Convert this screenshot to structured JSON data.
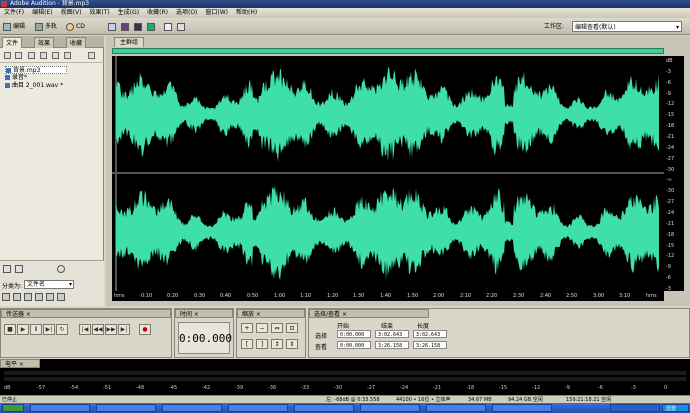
{
  "window": {
    "title": "Adobe Audition - 背景.mp3"
  },
  "menu": [
    "文件(F)",
    "编辑(E)",
    "视图(V)",
    "效果(T)",
    "生成(G)",
    "收藏(R)",
    "选项(O)",
    "窗口(W)",
    "帮助(H)"
  ],
  "toolbar": {
    "edit_label": "编辑",
    "multitrack_label": "多轨",
    "cd_label": "CD",
    "workspace_label": "工作区:",
    "workspace_value": "编辑查看(默认)"
  },
  "left_panel": {
    "tabs": [
      "文件",
      "效果",
      "收藏"
    ],
    "files": [
      "背景.mp3",
      "录音*",
      "曲目 2_001.wav *"
    ],
    "sort_label": "分类为:",
    "sort_value": "文件名"
  },
  "editor": {
    "tab_label": "主群组"
  },
  "db_scale": [
    "dB",
    "-3",
    "-6",
    "-9",
    "-12",
    "-15",
    "-18",
    "-21",
    "-24",
    "-27",
    "-30",
    "-∞",
    "-30",
    "-27",
    "-24",
    "-21",
    "-18",
    "-15",
    "-12",
    "-9",
    "-6",
    "-3"
  ],
  "timeline": [
    "hms",
    "0:10",
    "0:20",
    "0:30",
    "0:40",
    "0:50",
    "1:00",
    "1:10",
    "1:20",
    "1:30",
    "1:40",
    "1:50",
    "2:00",
    "2:10",
    "2:20",
    "2:30",
    "2:40",
    "2:50",
    "3:00",
    "3:10",
    "hms"
  ],
  "transport": {
    "title": "传送器"
  },
  "time_panel": {
    "title": "时间",
    "value": "0:00.000"
  },
  "zoom_panel": {
    "title": "缩放"
  },
  "selection_panel": {
    "title": "选择/查看",
    "headers": [
      "开始",
      "结束",
      "长度"
    ],
    "rows": [
      {
        "label": "选择",
        "start": "0:00.000",
        "end": "3:02.643",
        "length": "3:02.643"
      },
      {
        "label": "查看",
        "start": "0:00.000",
        "end": "3:26.158",
        "length": "3:26.158"
      }
    ]
  },
  "level_meter": {
    "title": "电平",
    "scale": [
      "dB",
      "-57",
      "-54",
      "-51",
      "-48",
      "-45",
      "-42",
      "-39",
      "-36",
      "-33",
      "-30",
      "-27",
      "-24",
      "-21",
      "-18",
      "-15",
      "-12",
      "-9",
      "-6",
      "-3",
      "0"
    ]
  },
  "status": {
    "left": "已停止",
    "level": "左: -68dB @ 0:33.558",
    "format": "44100 • 16位 • 立体声",
    "size": "34.67 MB",
    "free": "94.24 GB 空闲",
    "time": "159:21:18.21 空闲"
  },
  "taskbar": {
    "items": [
      "迅雷"
    ]
  },
  "colors": {
    "waveform": "#3fe0a8",
    "wave_bg": "#000000",
    "panel": "#dad6c9"
  }
}
